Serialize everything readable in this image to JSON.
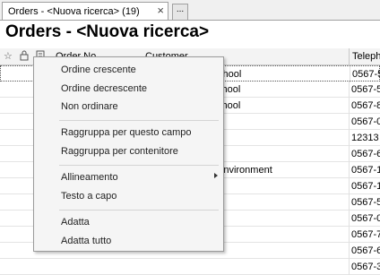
{
  "tab": {
    "label": "Orders - <Nuova ricerca> (19)",
    "close": "×",
    "more": "..."
  },
  "title": "Orders - <Nuova ricerca>",
  "header": {
    "order_no": "Order No.",
    "customer": "Customer",
    "telephone": "Teleph"
  },
  "rows": [
    {
      "customer": "chool",
      "tel": "0567-5"
    },
    {
      "customer": "chool",
      "tel": "0567-5"
    },
    {
      "customer": "chool",
      "tel": "0567-8"
    },
    {
      "customer": "",
      "tel": "0567-0"
    },
    {
      "customer": "",
      "tel": "12313"
    },
    {
      "customer": "",
      "tel": "0567-6"
    },
    {
      "customer": "Environment",
      "tel": "0567-1"
    },
    {
      "customer": "",
      "tel": "0567-1"
    },
    {
      "customer": "",
      "tel": "0567-5"
    },
    {
      "customer": "",
      "tel": "0567-0"
    },
    {
      "customer": "",
      "tel": "0567-7"
    },
    {
      "customer": "",
      "tel": "0567-6"
    },
    {
      "customer": "",
      "tel": "0567-3"
    }
  ],
  "menu": {
    "sort_asc": "Ordine crescente",
    "sort_desc": "Ordine decrescente",
    "no_sort": "Non ordinare",
    "group_field": "Raggruppa per questo campo",
    "group_container": "Raggruppa per contenitore",
    "alignment": "Allineamento",
    "wrap": "Testo a capo",
    "fit": "Adatta",
    "fit_all": "Adatta tutto"
  }
}
